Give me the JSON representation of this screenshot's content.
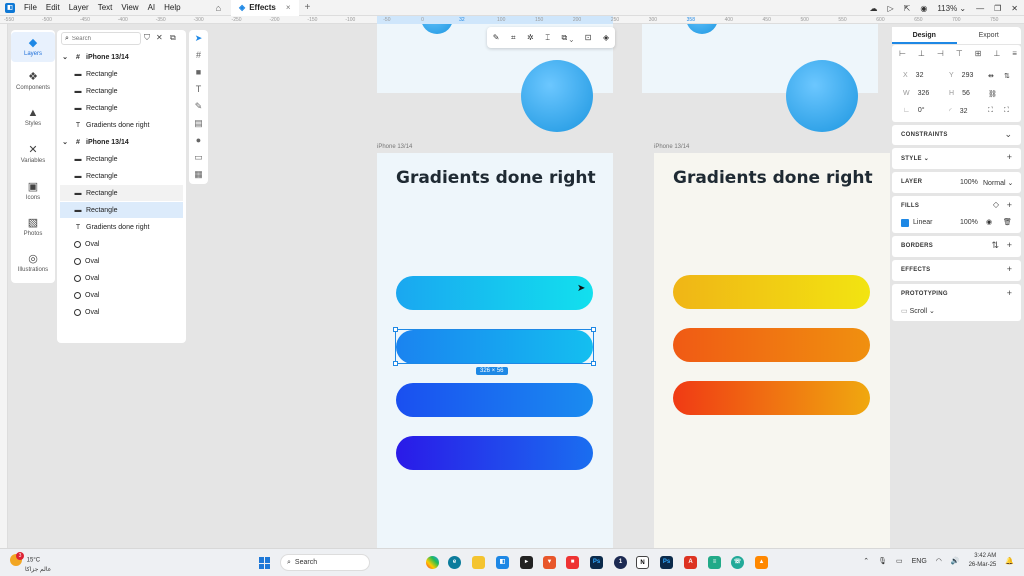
{
  "menu": [
    "File",
    "Edit",
    "Layer",
    "Text",
    "View",
    "AI",
    "Help"
  ],
  "tab": {
    "label": "Effects"
  },
  "zoom": "113%",
  "ruler": {
    "marks": [
      "-550",
      "-500",
      "-450",
      "-400",
      "-350",
      "-300",
      "-250",
      "-200",
      "-150",
      "-100",
      "-50",
      "0",
      "32",
      "100",
      "150",
      "200",
      "250",
      "300",
      "358",
      "400",
      "450",
      "500",
      "550",
      "600",
      "650",
      "700",
      "750"
    ]
  },
  "nav": [
    {
      "label": "Layers",
      "icon": "layers-icon"
    },
    {
      "label": "Components",
      "icon": "components-icon"
    },
    {
      "label": "Styles",
      "icon": "styles-icon"
    },
    {
      "label": "Variables",
      "icon": "variables-icon"
    },
    {
      "label": "Icons",
      "icon": "icons-icon"
    },
    {
      "label": "Photos",
      "icon": "photos-icon"
    },
    {
      "label": "Illustrations",
      "icon": "illustrations-icon"
    }
  ],
  "layers": {
    "search_placeholder": "Search",
    "items": [
      {
        "label": "iPhone 13/14",
        "type": "frame"
      },
      {
        "label": "Rectangle",
        "type": "rect"
      },
      {
        "label": "Rectangle",
        "type": "rect"
      },
      {
        "label": "Rectangle",
        "type": "rect"
      },
      {
        "label": "Gradients done right",
        "type": "text"
      },
      {
        "label": "iPhone 13/14",
        "type": "frame"
      },
      {
        "label": "Rectangle",
        "type": "rect"
      },
      {
        "label": "Rectangle",
        "type": "rect"
      },
      {
        "label": "Rectangle",
        "type": "rect",
        "state": "hover"
      },
      {
        "label": "Rectangle",
        "type": "rect",
        "state": "selected"
      },
      {
        "label": "Gradients done right",
        "type": "text"
      },
      {
        "label": "Oval",
        "type": "oval"
      },
      {
        "label": "Oval",
        "type": "oval"
      },
      {
        "label": "Oval",
        "type": "oval"
      },
      {
        "label": "Oval",
        "type": "oval"
      },
      {
        "label": "Oval",
        "type": "oval"
      }
    ]
  },
  "canvas": {
    "frame_label_left": "iPhone 13/14",
    "frame_label_right": "iPhone 13/14",
    "heading_left": "Gradients done right",
    "heading_right": "Gradients done right",
    "selection_size": "326 × 56",
    "pill_colors": {
      "left": [
        [
          "#1aa7f0",
          "#12e0ee"
        ],
        [
          "#1a83f0",
          "#14bff0"
        ],
        [
          "#1a4ff0",
          "#1a8cf0"
        ],
        [
          "#2a1ae8",
          "#1a6ef0"
        ]
      ],
      "right": [
        [
          "#f0b516",
          "#f2e411"
        ],
        [
          "#f05a14",
          "#f0900f"
        ],
        [
          "#f03a14",
          "#f0a80f"
        ]
      ]
    }
  },
  "inspector": {
    "tabs": [
      "Design",
      "Export"
    ],
    "x": "32",
    "y": "293",
    "w": "326",
    "h": "56",
    "rotation": "0°",
    "radius": "32",
    "sections": {
      "constraints": "CONSTRAINTS",
      "style": "STYLE",
      "layer": "LAYER",
      "fills": "FILLS",
      "borders": "BORDERS",
      "effects": "EFFECTS",
      "prototyping": "PROTOTYPING"
    },
    "layer_opacity": "100%",
    "blend_mode": "Normal",
    "fill_type": "Linear",
    "fill_opacity": "100%",
    "fill_color": "#1e88e5",
    "scroll": "Scroll"
  },
  "taskbar": {
    "temperature": "15°C",
    "location": "عالم جزاكا",
    "search": "Search",
    "language": "ENG",
    "time": "3:42 AM",
    "date": "26-Mar-25",
    "notification_count": "3"
  }
}
